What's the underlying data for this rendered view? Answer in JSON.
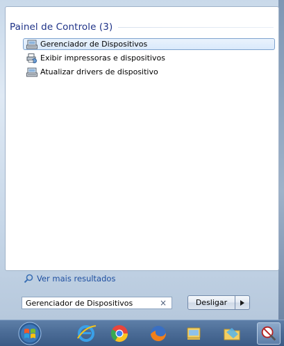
{
  "results": {
    "group_title": "Painel de Controle (3)",
    "items": [
      {
        "label": "Gerenciador de Dispositivos",
        "icon": "device-manager-icon",
        "selected": true
      },
      {
        "label": "Exibir impressoras e dispositivos",
        "icon": "printers-devices-icon",
        "selected": false
      },
      {
        "label": "Atualizar drivers de dispositivo",
        "icon": "device-driver-icon",
        "selected": false
      }
    ],
    "see_more": "Ver mais resultados"
  },
  "search": {
    "value": "Gerenciador de Dispositivos",
    "clear_glyph": "×"
  },
  "shutdown": {
    "label": "Desligar"
  },
  "taskbar": {
    "items": [
      "start-orb-icon",
      "internet-explorer-icon",
      "chrome-icon",
      "firefox-icon",
      "windows-explorer-icon",
      "folder-icon",
      "snipping-tool-icon"
    ]
  }
}
